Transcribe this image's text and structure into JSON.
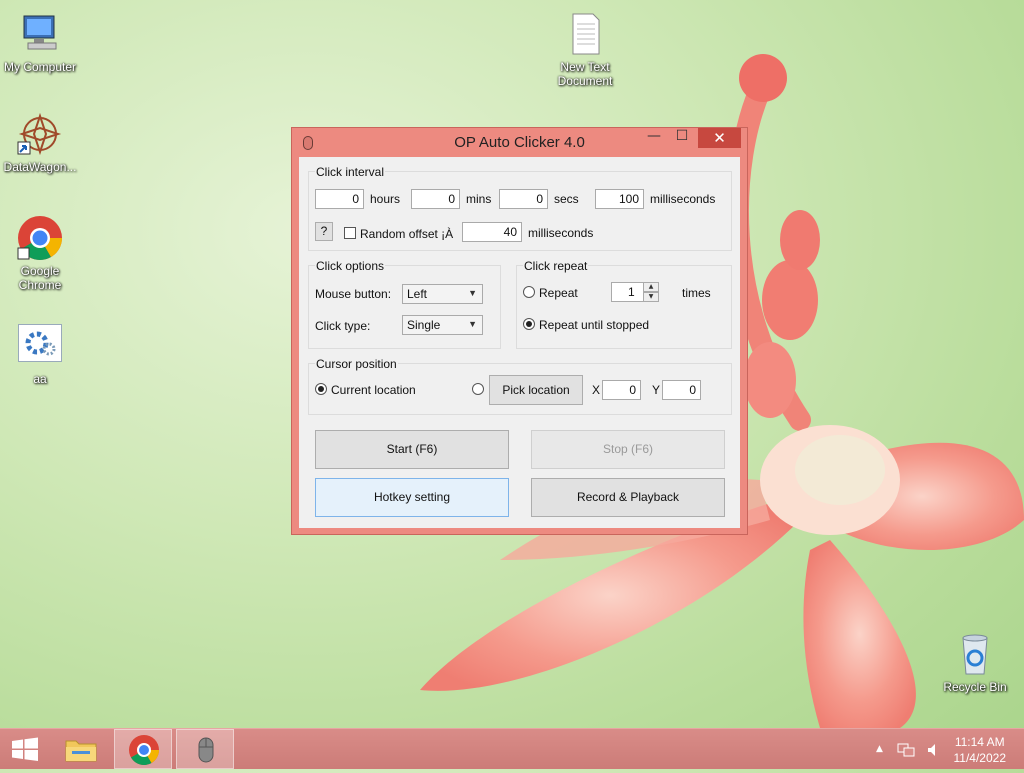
{
  "desktop": {
    "icons": [
      {
        "label": "My Computer",
        "icon": "computer-icon"
      },
      {
        "label": "DataWagon...",
        "icon": "datawagon-icon"
      },
      {
        "label": "Google Chrome",
        "icon": "chrome-icon"
      },
      {
        "label": "aa",
        "icon": "settings-gear-icon"
      },
      {
        "label": "New Text Document",
        "icon": "text-document-icon"
      },
      {
        "label": "Recycle Bin",
        "icon": "recycle-bin-icon"
      }
    ]
  },
  "window": {
    "title": "OP Auto Clicker 4.0",
    "controls": {
      "minimize": "—",
      "maximize": "☐",
      "close": "✕"
    },
    "click_interval": {
      "label": "Click interval",
      "hours": "0",
      "hours_label": "hours",
      "mins": "0",
      "mins_label": "mins",
      "secs": "0",
      "secs_label": "secs",
      "ms": "100",
      "ms_label": "milliseconds",
      "help": "?",
      "random_offset_label": "Random offset ¡À",
      "random_offset_checked": false,
      "offset_ms": "40",
      "offset_ms_label": "milliseconds"
    },
    "click_options": {
      "label": "Click options",
      "mouse_button_label": "Mouse button:",
      "mouse_button": "Left",
      "click_type_label": "Click type:",
      "click_type": "Single"
    },
    "click_repeat": {
      "label": "Click repeat",
      "repeat_label": "Repeat",
      "repeat_count": "1",
      "times_label": "times",
      "until_stopped_label": "Repeat until stopped",
      "selected": "until_stopped"
    },
    "cursor_position": {
      "label": "Cursor position",
      "current_label": "Current location",
      "pick_label": "Pick location",
      "x_label": "X",
      "x": "0",
      "y_label": "Y",
      "y": "0",
      "selected": "current"
    },
    "buttons": {
      "start": "Start (F6)",
      "stop": "Stop (F6)",
      "hotkey": "Hotkey setting",
      "record": "Record & Playback"
    }
  },
  "taskbar": {
    "clock_time": "11:14 AM",
    "clock_date": "11/4/2022",
    "tray_chevron": "▲"
  },
  "colors": {
    "window_frame": "#ed8a80",
    "close_button": "#c7483f",
    "taskbar": "#d98c88"
  }
}
